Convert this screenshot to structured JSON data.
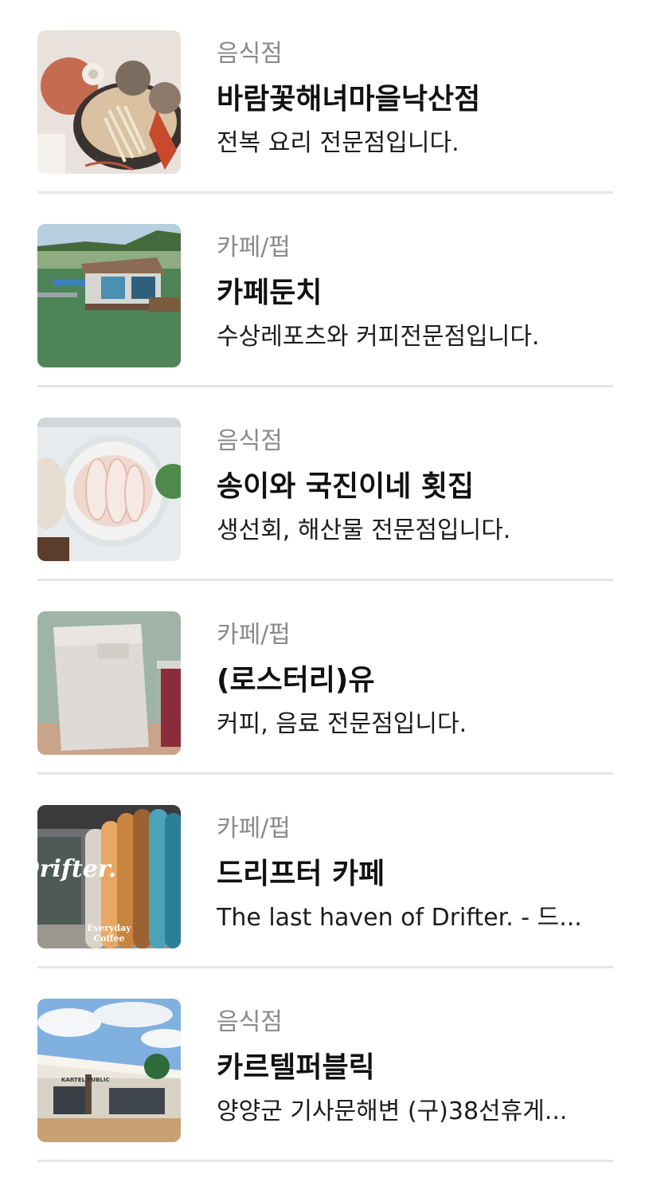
{
  "places": [
    {
      "category": "음식점",
      "name": "바람꽃해녀마을낙산점",
      "description": "전복 요리 전문점입니다.",
      "thumbnail": "seafood-platter-photo"
    },
    {
      "category": "카페/펍",
      "name": "카페둔치",
      "description": "수상레포츠와 커피전문점입니다.",
      "thumbnail": "lake-cafe-photo"
    },
    {
      "category": "음식점",
      "name": "송이와 국진이네 횟집",
      "description": "생선회, 해산물 전문점입니다.",
      "thumbnail": "sashimi-plate-photo"
    },
    {
      "category": "카페/펍",
      "name": "(로스터리)유",
      "description": "커피, 음료 전문점입니다.",
      "thumbnail": "coffee-bag-photo"
    },
    {
      "category": "카페/펍",
      "name": "드리프터 카페",
      "description": "The last haven of Drifter. - 드...",
      "thumbnail": "surfboards-photo",
      "thumbnail_text": [
        "Drifter.",
        "Everyday",
        "Coffee"
      ]
    },
    {
      "category": "음식점",
      "name": "카르텔퍼블릭",
      "description": "양양군 기사문해변 (구)38선휴게...",
      "thumbnail": "restaurant-exterior-photo",
      "thumbnail_text": [
        "KARTEL PUBLIC"
      ]
    }
  ]
}
